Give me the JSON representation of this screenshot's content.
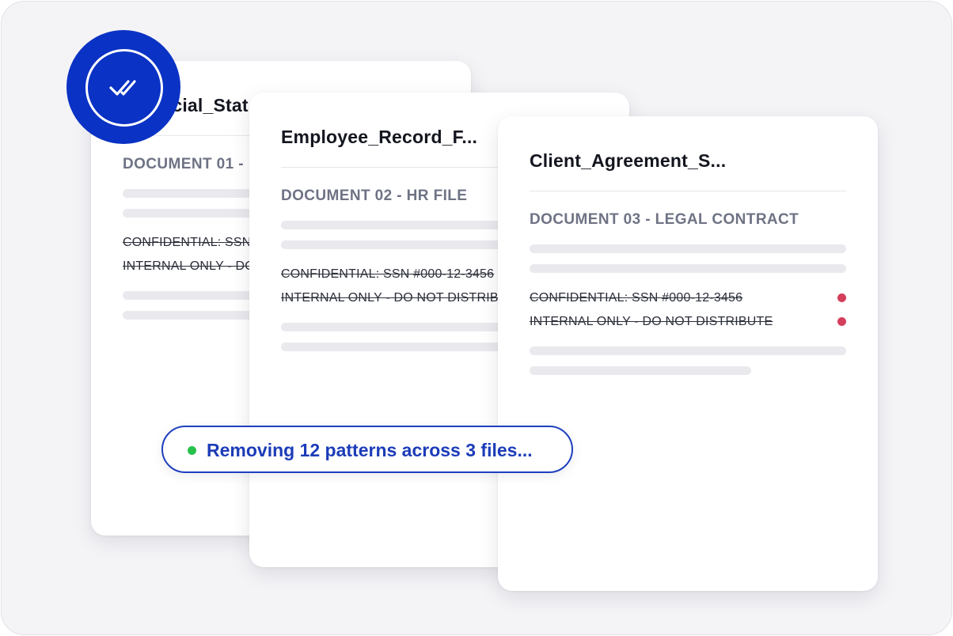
{
  "documents": [
    {
      "title": "Financial_Stat",
      "subtitle": "DOCUMENT 01 - ",
      "redacted_lines": [
        "CONFIDENTIAL: SSN #000-12-3456",
        "INTERNAL ONLY - DO NOT DISTRIBUTE"
      ]
    },
    {
      "title": "Employee_Record_F...",
      "subtitle": "DOCUMENT 02 - HR FILE",
      "redacted_lines": [
        "CONFIDENTIAL: SSN #000-12-3456",
        "INTERNAL ONLY - DO NOT DISTRIBUTE"
      ]
    },
    {
      "title": "Client_Agreement_S...",
      "subtitle": "DOCUMENT 03 - LEGAL CONTRACT",
      "redacted_lines": [
        "CONFIDENTIAL: SSN #000-12-3456",
        "INTERNAL ONLY - DO NOT DISTRIBUTE"
      ]
    }
  ],
  "status": {
    "text": "Removing 12 patterns across 3 files...",
    "indicator_color": "#27c24c"
  },
  "badge": {
    "icon": "double-check-icon",
    "color": "#0a32c4"
  },
  "colors": {
    "accent": "#1c3cb8",
    "flag": "#d43f5b"
  }
}
